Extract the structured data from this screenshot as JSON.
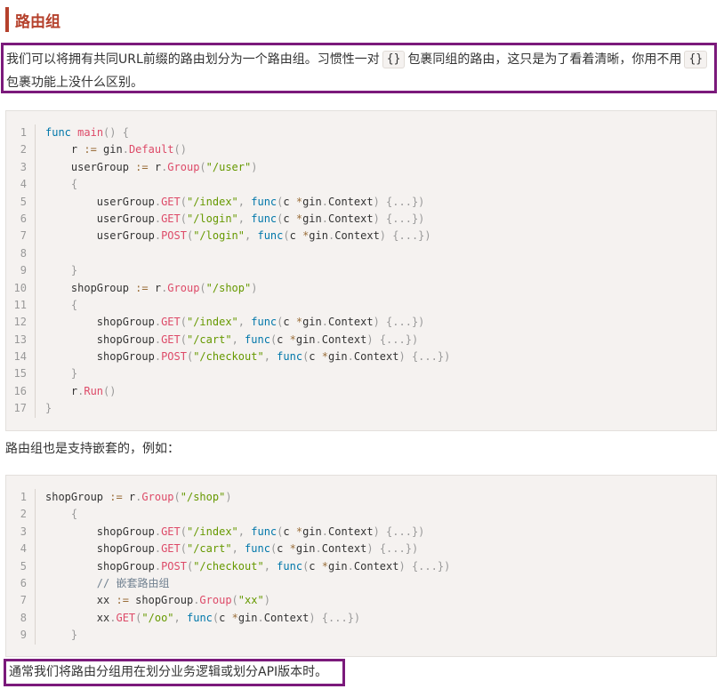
{
  "heading": "路由组",
  "intro": {
    "part1": "我们可以将拥有共同URL前缀的路由划分为一个路由组。习惯性一对",
    "code1": "{}",
    "part2": "包裹同组的路由，这只是为了看着清晰，你用不用",
    "code2": "{}",
    "part3": "包裹功能上没什么区别。"
  },
  "nested_intro": "路由组也是支持嵌套的，例如：",
  "summary": "通常我们将路由分组用在划分业务逻辑或划分API版本时。",
  "code_blocks": [
    {
      "lines": [
        [
          [
            "kw",
            "func"
          ],
          [
            "tx",
            " "
          ],
          [
            "fn",
            "main"
          ],
          [
            "pn",
            "()"
          ],
          [
            "tx",
            " "
          ],
          [
            "pn",
            "{"
          ]
        ],
        [
          [
            "tx",
            "    r "
          ],
          [
            "op",
            ":="
          ],
          [
            "tx",
            " gin"
          ],
          [
            "pn",
            "."
          ],
          [
            "fn",
            "Default"
          ],
          [
            "pn",
            "()"
          ]
        ],
        [
          [
            "tx",
            "    userGroup "
          ],
          [
            "op",
            ":="
          ],
          [
            "tx",
            " r"
          ],
          [
            "pn",
            "."
          ],
          [
            "fn",
            "Group"
          ],
          [
            "pn",
            "("
          ],
          [
            "str",
            "\"/user\""
          ],
          [
            "pn",
            ")"
          ]
        ],
        [
          [
            "tx",
            "    "
          ],
          [
            "pn",
            "{"
          ]
        ],
        [
          [
            "tx",
            "        userGroup"
          ],
          [
            "pn",
            "."
          ],
          [
            "fn",
            "GET"
          ],
          [
            "pn",
            "("
          ],
          [
            "str",
            "\"/index\""
          ],
          [
            "pn",
            ","
          ],
          [
            "tx",
            " "
          ],
          [
            "kw",
            "func"
          ],
          [
            "pn",
            "("
          ],
          [
            "tx",
            "c "
          ],
          [
            "op",
            "*"
          ],
          [
            "tx",
            "gin"
          ],
          [
            "pn",
            "."
          ],
          [
            "tx",
            "Context"
          ],
          [
            "pn",
            ")"
          ],
          [
            "tx",
            " "
          ],
          [
            "pn",
            "{...})"
          ]
        ],
        [
          [
            "tx",
            "        userGroup"
          ],
          [
            "pn",
            "."
          ],
          [
            "fn",
            "GET"
          ],
          [
            "pn",
            "("
          ],
          [
            "str",
            "\"/login\""
          ],
          [
            "pn",
            ","
          ],
          [
            "tx",
            " "
          ],
          [
            "kw",
            "func"
          ],
          [
            "pn",
            "("
          ],
          [
            "tx",
            "c "
          ],
          [
            "op",
            "*"
          ],
          [
            "tx",
            "gin"
          ],
          [
            "pn",
            "."
          ],
          [
            "tx",
            "Context"
          ],
          [
            "pn",
            ")"
          ],
          [
            "tx",
            " "
          ],
          [
            "pn",
            "{...})"
          ]
        ],
        [
          [
            "tx",
            "        userGroup"
          ],
          [
            "pn",
            "."
          ],
          [
            "fn",
            "POST"
          ],
          [
            "pn",
            "("
          ],
          [
            "str",
            "\"/login\""
          ],
          [
            "pn",
            ","
          ],
          [
            "tx",
            " "
          ],
          [
            "kw",
            "func"
          ],
          [
            "pn",
            "("
          ],
          [
            "tx",
            "c "
          ],
          [
            "op",
            "*"
          ],
          [
            "tx",
            "gin"
          ],
          [
            "pn",
            "."
          ],
          [
            "tx",
            "Context"
          ],
          [
            "pn",
            ")"
          ],
          [
            "tx",
            " "
          ],
          [
            "pn",
            "{...})"
          ]
        ],
        [],
        [
          [
            "tx",
            "    "
          ],
          [
            "pn",
            "}"
          ]
        ],
        [
          [
            "tx",
            "    shopGroup "
          ],
          [
            "op",
            ":="
          ],
          [
            "tx",
            " r"
          ],
          [
            "pn",
            "."
          ],
          [
            "fn",
            "Group"
          ],
          [
            "pn",
            "("
          ],
          [
            "str",
            "\"/shop\""
          ],
          [
            "pn",
            ")"
          ]
        ],
        [
          [
            "tx",
            "    "
          ],
          [
            "pn",
            "{"
          ]
        ],
        [
          [
            "tx",
            "        shopGroup"
          ],
          [
            "pn",
            "."
          ],
          [
            "fn",
            "GET"
          ],
          [
            "pn",
            "("
          ],
          [
            "str",
            "\"/index\""
          ],
          [
            "pn",
            ","
          ],
          [
            "tx",
            " "
          ],
          [
            "kw",
            "func"
          ],
          [
            "pn",
            "("
          ],
          [
            "tx",
            "c "
          ],
          [
            "op",
            "*"
          ],
          [
            "tx",
            "gin"
          ],
          [
            "pn",
            "."
          ],
          [
            "tx",
            "Context"
          ],
          [
            "pn",
            ")"
          ],
          [
            "tx",
            " "
          ],
          [
            "pn",
            "{...})"
          ]
        ],
        [
          [
            "tx",
            "        shopGroup"
          ],
          [
            "pn",
            "."
          ],
          [
            "fn",
            "GET"
          ],
          [
            "pn",
            "("
          ],
          [
            "str",
            "\"/cart\""
          ],
          [
            "pn",
            ","
          ],
          [
            "tx",
            " "
          ],
          [
            "kw",
            "func"
          ],
          [
            "pn",
            "("
          ],
          [
            "tx",
            "c "
          ],
          [
            "op",
            "*"
          ],
          [
            "tx",
            "gin"
          ],
          [
            "pn",
            "."
          ],
          [
            "tx",
            "Context"
          ],
          [
            "pn",
            ")"
          ],
          [
            "tx",
            " "
          ],
          [
            "pn",
            "{...})"
          ]
        ],
        [
          [
            "tx",
            "        shopGroup"
          ],
          [
            "pn",
            "."
          ],
          [
            "fn",
            "POST"
          ],
          [
            "pn",
            "("
          ],
          [
            "str",
            "\"/checkout\""
          ],
          [
            "pn",
            ","
          ],
          [
            "tx",
            " "
          ],
          [
            "kw",
            "func"
          ],
          [
            "pn",
            "("
          ],
          [
            "tx",
            "c "
          ],
          [
            "op",
            "*"
          ],
          [
            "tx",
            "gin"
          ],
          [
            "pn",
            "."
          ],
          [
            "tx",
            "Context"
          ],
          [
            "pn",
            ")"
          ],
          [
            "tx",
            " "
          ],
          [
            "pn",
            "{...})"
          ]
        ],
        [
          [
            "tx",
            "    "
          ],
          [
            "pn",
            "}"
          ]
        ],
        [
          [
            "tx",
            "    r"
          ],
          [
            "pn",
            "."
          ],
          [
            "fn",
            "Run"
          ],
          [
            "pn",
            "()"
          ]
        ],
        [
          [
            "pn",
            "}"
          ]
        ]
      ]
    },
    {
      "lines": [
        [
          [
            "tx",
            "shopGroup "
          ],
          [
            "op",
            ":="
          ],
          [
            "tx",
            " r"
          ],
          [
            "pn",
            "."
          ],
          [
            "fn",
            "Group"
          ],
          [
            "pn",
            "("
          ],
          [
            "str",
            "\"/shop\""
          ],
          [
            "pn",
            ")"
          ]
        ],
        [
          [
            "tx",
            "    "
          ],
          [
            "pn",
            "{"
          ]
        ],
        [
          [
            "tx",
            "        shopGroup"
          ],
          [
            "pn",
            "."
          ],
          [
            "fn",
            "GET"
          ],
          [
            "pn",
            "("
          ],
          [
            "str",
            "\"/index\""
          ],
          [
            "pn",
            ","
          ],
          [
            "tx",
            " "
          ],
          [
            "kw",
            "func"
          ],
          [
            "pn",
            "("
          ],
          [
            "tx",
            "c "
          ],
          [
            "op",
            "*"
          ],
          [
            "tx",
            "gin"
          ],
          [
            "pn",
            "."
          ],
          [
            "tx",
            "Context"
          ],
          [
            "pn",
            ")"
          ],
          [
            "tx",
            " "
          ],
          [
            "pn",
            "{...})"
          ]
        ],
        [
          [
            "tx",
            "        shopGroup"
          ],
          [
            "pn",
            "."
          ],
          [
            "fn",
            "GET"
          ],
          [
            "pn",
            "("
          ],
          [
            "str",
            "\"/cart\""
          ],
          [
            "pn",
            ","
          ],
          [
            "tx",
            " "
          ],
          [
            "kw",
            "func"
          ],
          [
            "pn",
            "("
          ],
          [
            "tx",
            "c "
          ],
          [
            "op",
            "*"
          ],
          [
            "tx",
            "gin"
          ],
          [
            "pn",
            "."
          ],
          [
            "tx",
            "Context"
          ],
          [
            "pn",
            ")"
          ],
          [
            "tx",
            " "
          ],
          [
            "pn",
            "{...})"
          ]
        ],
        [
          [
            "tx",
            "        shopGroup"
          ],
          [
            "pn",
            "."
          ],
          [
            "fn",
            "POST"
          ],
          [
            "pn",
            "("
          ],
          [
            "str",
            "\"/checkout\""
          ],
          [
            "pn",
            ","
          ],
          [
            "tx",
            " "
          ],
          [
            "kw",
            "func"
          ],
          [
            "pn",
            "("
          ],
          [
            "tx",
            "c "
          ],
          [
            "op",
            "*"
          ],
          [
            "tx",
            "gin"
          ],
          [
            "pn",
            "."
          ],
          [
            "tx",
            "Context"
          ],
          [
            "pn",
            ")"
          ],
          [
            "tx",
            " "
          ],
          [
            "pn",
            "{...})"
          ]
        ],
        [
          [
            "tx",
            "        "
          ],
          [
            "cm",
            "// 嵌套路由组"
          ]
        ],
        [
          [
            "tx",
            "        xx "
          ],
          [
            "op",
            ":="
          ],
          [
            "tx",
            " shopGroup"
          ],
          [
            "pn",
            "."
          ],
          [
            "fn",
            "Group"
          ],
          [
            "pn",
            "("
          ],
          [
            "str",
            "\"xx\""
          ],
          [
            "pn",
            ")"
          ]
        ],
        [
          [
            "tx",
            "        xx"
          ],
          [
            "pn",
            "."
          ],
          [
            "fn",
            "GET"
          ],
          [
            "pn",
            "("
          ],
          [
            "str",
            "\"/oo\""
          ],
          [
            "pn",
            ","
          ],
          [
            "tx",
            " "
          ],
          [
            "kw",
            "func"
          ],
          [
            "pn",
            "("
          ],
          [
            "tx",
            "c "
          ],
          [
            "op",
            "*"
          ],
          [
            "tx",
            "gin"
          ],
          [
            "pn",
            "."
          ],
          [
            "tx",
            "Context"
          ],
          [
            "pn",
            ")"
          ],
          [
            "tx",
            " "
          ],
          [
            "pn",
            "{...})"
          ]
        ],
        [
          [
            "tx",
            "    "
          ],
          [
            "pn",
            "}"
          ]
        ]
      ]
    }
  ]
}
